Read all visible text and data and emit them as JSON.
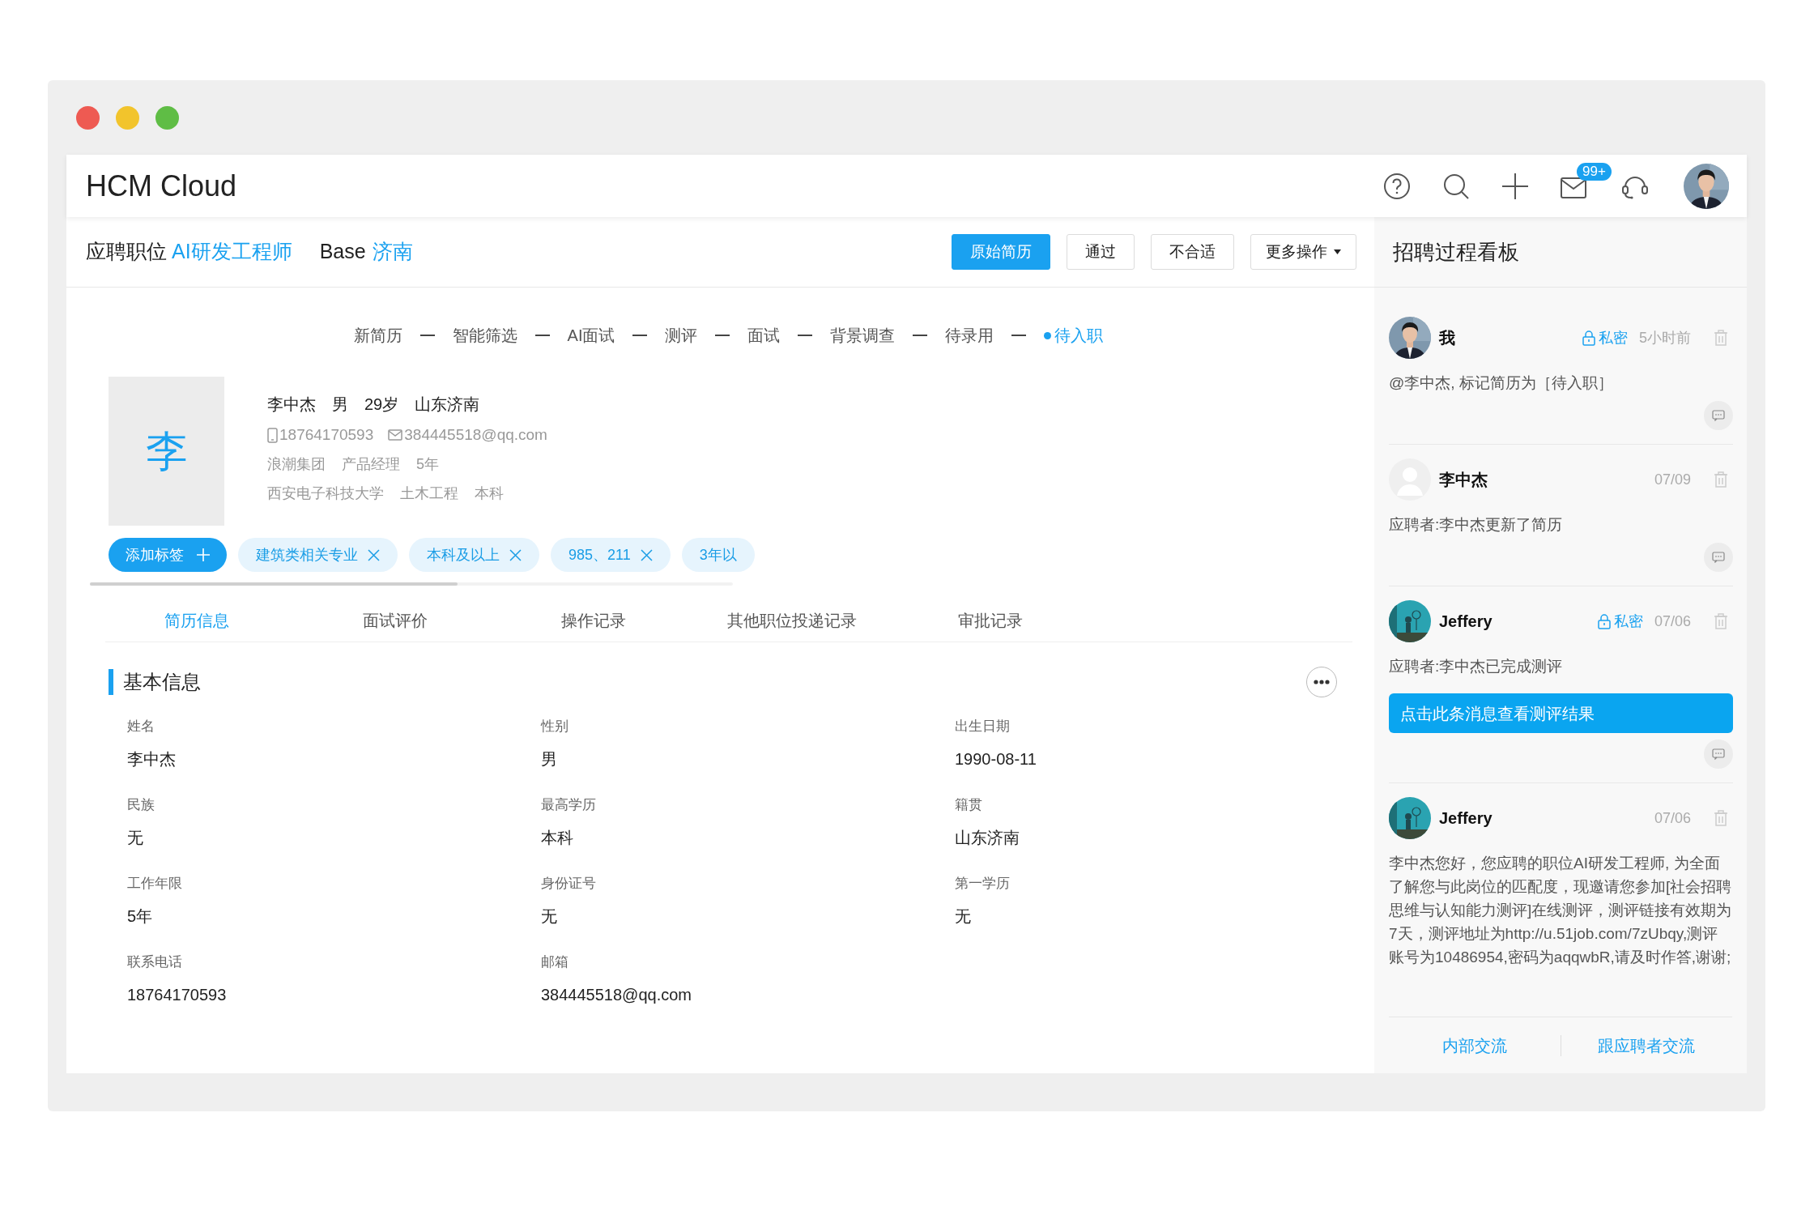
{
  "app": {
    "title": "HCM Cloud",
    "mail_badge": "99+"
  },
  "job": {
    "position_label": "应聘职位",
    "position": "AI研发工程师",
    "base_label": "Base",
    "base": "济南"
  },
  "actions": [
    {
      "label": "原始简历",
      "primary": true,
      "menu": false
    },
    {
      "label": "通过",
      "primary": false,
      "menu": false
    },
    {
      "label": "不合适",
      "primary": false,
      "menu": false
    },
    {
      "label": "更多操作",
      "primary": false,
      "menu": true
    }
  ],
  "stages": [
    {
      "label": "新简历",
      "selected": false
    },
    {
      "label": "智能筛选",
      "selected": false
    },
    {
      "label": "AI面试",
      "selected": false
    },
    {
      "label": "测评",
      "selected": false
    },
    {
      "label": "面试",
      "selected": false
    },
    {
      "label": "背景调查",
      "selected": false
    },
    {
      "label": "待录用",
      "selected": false
    },
    {
      "label": "待入职",
      "selected": true
    }
  ],
  "candidate": {
    "initial": "李",
    "summary": [
      "李中杰",
      "男",
      "29岁",
      "山东济南"
    ],
    "phone": "18764170593",
    "email": "384445518@qq.com",
    "work": [
      "浪潮集团",
      "产品经理",
      "5年"
    ],
    "education": [
      "西安电子科技大学",
      "土木工程",
      "本科"
    ]
  },
  "tags": {
    "add_label": "添加标签",
    "items": [
      {
        "label": "建筑类相关专业",
        "removable": true
      },
      {
        "label": "本科及以上",
        "removable": true
      },
      {
        "label": "985、211",
        "removable": true
      },
      {
        "label": "3年以",
        "removable": false
      }
    ]
  },
  "tabs": [
    {
      "label": "简历信息",
      "selected": true
    },
    {
      "label": "面试评价",
      "selected": false
    },
    {
      "label": "操作记录",
      "selected": false
    },
    {
      "label": "其他职位投递记录",
      "selected": false
    },
    {
      "label": "审批记录",
      "selected": false
    }
  ],
  "section": {
    "title": "基本信息"
  },
  "fields": [
    {
      "label": "姓名",
      "value": "李中杰"
    },
    {
      "label": "性别",
      "value": "男"
    },
    {
      "label": "出生日期",
      "value": "1990-08-11"
    },
    {
      "label": "民族",
      "value": "无"
    },
    {
      "label": "最高学历",
      "value": "本科"
    },
    {
      "label": "籍贯",
      "value": "山东济南"
    },
    {
      "label": "工作年限",
      "value": "5年"
    },
    {
      "label": "身份证号",
      "value": "无"
    },
    {
      "label": "第一学历",
      "value": "无"
    },
    {
      "label": "联系电话",
      "value": "18764170593"
    },
    {
      "label": "邮箱",
      "value": "384445518@qq.com"
    }
  ],
  "board": {
    "title": "招聘过程看板",
    "entries": [
      {
        "avatar": {
          "kind": "portrait"
        },
        "author": "我",
        "private_label": "私密",
        "time": "5小时前",
        "text": "@李中杰, 标记简历为［待入职］",
        "comment": true
      },
      {
        "avatar": {
          "kind": "placeholder"
        },
        "author": "李中杰",
        "time": "07/09",
        "text": "应聘者:李中杰更新了简历",
        "comment": true
      },
      {
        "avatar": {
          "kind": "sketch"
        },
        "author": "Jeffery",
        "private_label": "私密",
        "time": "07/06",
        "text": "应聘者:李中杰已完成测评",
        "action": "点击此条消息查看测评结果",
        "comment": true
      },
      {
        "avatar": {
          "kind": "sketch"
        },
        "author": "Jeffery",
        "time": "07/06",
        "text": "李中杰您好，您应聘的职位AI研发工程师, 为全面了解您与此岗位的匹配度，现邀请您参加[社会招聘思维与认知能力测评]在线测评，测评链接有效期为7天，测评地址为http://u.51job.com/7zUbqy,测评账号为10486954,密码为aqqwbR,请及时作答,谢谢;",
        "comment": false
      }
    ],
    "footer": [
      "内部交流",
      "跟应聘者交流"
    ]
  }
}
